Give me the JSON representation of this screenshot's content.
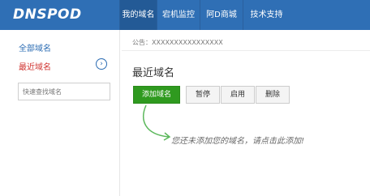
{
  "header": {
    "logo": "DNSPOD",
    "nav": [
      {
        "label": "我的域名",
        "active": true
      },
      {
        "label": "宕机监控",
        "active": false
      },
      {
        "label": "阿D商城",
        "active": false
      },
      {
        "label": "技术支持",
        "active": false
      }
    ],
    "bg_color": "#2f6fb5"
  },
  "sidebar": {
    "all_domains": "全部域名",
    "recent_domains": "最近域名",
    "search_placeholder": "快速查找域名"
  },
  "main": {
    "notice": "公告：XXXXXXXXXXXXXXXX",
    "title": "最近域名",
    "buttons": {
      "add": "添加域名",
      "pause": "暂停",
      "enable": "启用",
      "delete": "删除"
    },
    "empty_hint": "您还未添加您的域名，请点击此添加!",
    "add_color": "#2f9a1f"
  },
  "icons": {
    "recent_expand": "chevron-right-icon",
    "hint_arrow": "curved-arrow-icon"
  }
}
